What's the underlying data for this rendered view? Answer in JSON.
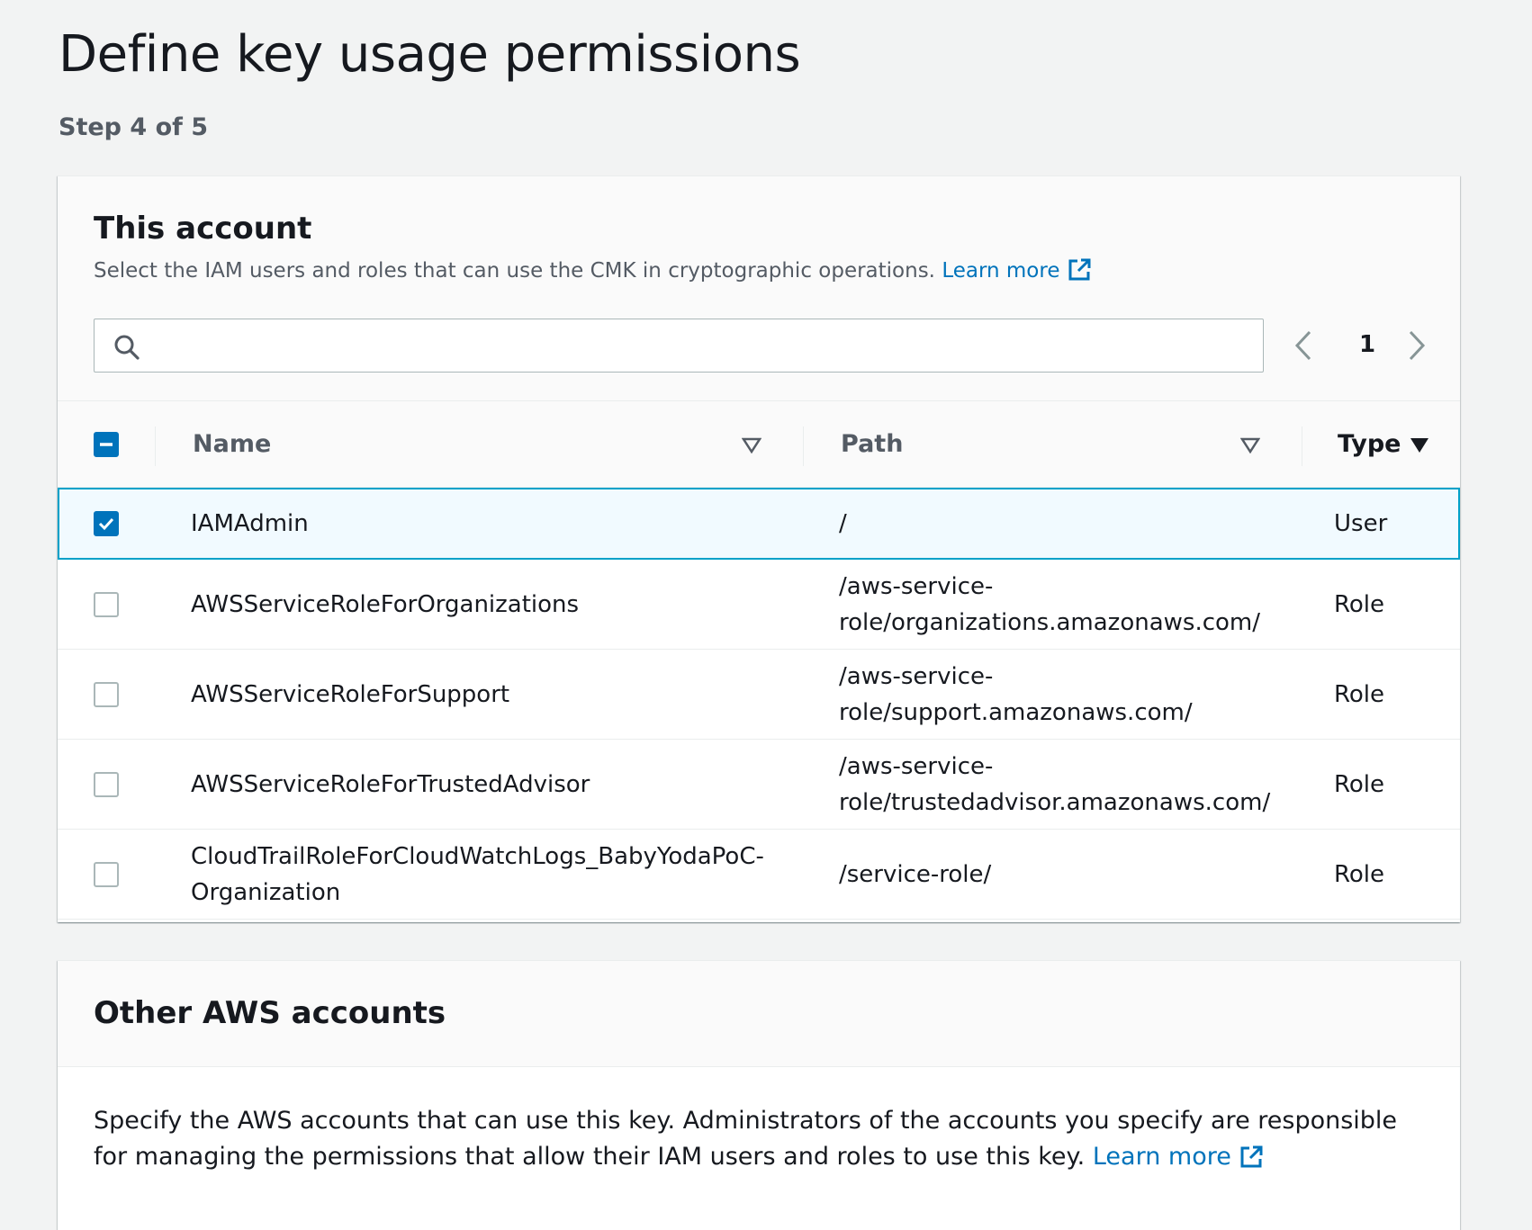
{
  "page": {
    "title": "Define key usage permissions",
    "step": "Step 4 of 5"
  },
  "this_account": {
    "title": "This account",
    "description": "Select the IAM users and roles that can use the CMK in cryptographic operations.",
    "learn_more": "Learn more",
    "search": {
      "value": "",
      "placeholder": ""
    },
    "pagination": {
      "current_page": "1"
    },
    "table": {
      "columns": [
        {
          "label": "Name",
          "sort": "none"
        },
        {
          "label": "Path",
          "sort": "none"
        },
        {
          "label": "Type",
          "sort": "descending"
        }
      ],
      "rows": [
        {
          "checked": true,
          "name": "IAMAdmin",
          "path": "/",
          "type": "User"
        },
        {
          "checked": false,
          "name": "AWSServiceRoleForOrganizations",
          "path_line1": "/aws-service-",
          "path_line2": "role/organizations.amazonaws.com/",
          "type": "Role"
        },
        {
          "checked": false,
          "name": "AWSServiceRoleForSupport",
          "path_line1": "/aws-service-",
          "path_line2": "role/support.amazonaws.com/",
          "type": "Role"
        },
        {
          "checked": false,
          "name": "AWSServiceRoleForTrustedAdvisor",
          "path_line1": "/aws-service-",
          "path_line2": "role/trustedadvisor.amazonaws.com/",
          "type": "Role"
        },
        {
          "checked": false,
          "name_line1": "CloudTrailRoleForCloudWatchLogs_BabyYodaPoC-",
          "name_line2": "Organization",
          "path": "/service-role/",
          "type": "Role"
        }
      ]
    }
  },
  "other_accounts": {
    "title": "Other AWS accounts",
    "description": "Specify the AWS accounts that can use this key. Administrators of the accounts you specify are responsible for managing the permissions that allow their IAM users and roles to use this key.",
    "learn_more": "Learn more"
  },
  "colors": {
    "link": "#0073bb",
    "selected_row_bg": "#f1faff",
    "selected_row_border": "#00a1c9",
    "checkbox_checked": "#0073bb"
  }
}
